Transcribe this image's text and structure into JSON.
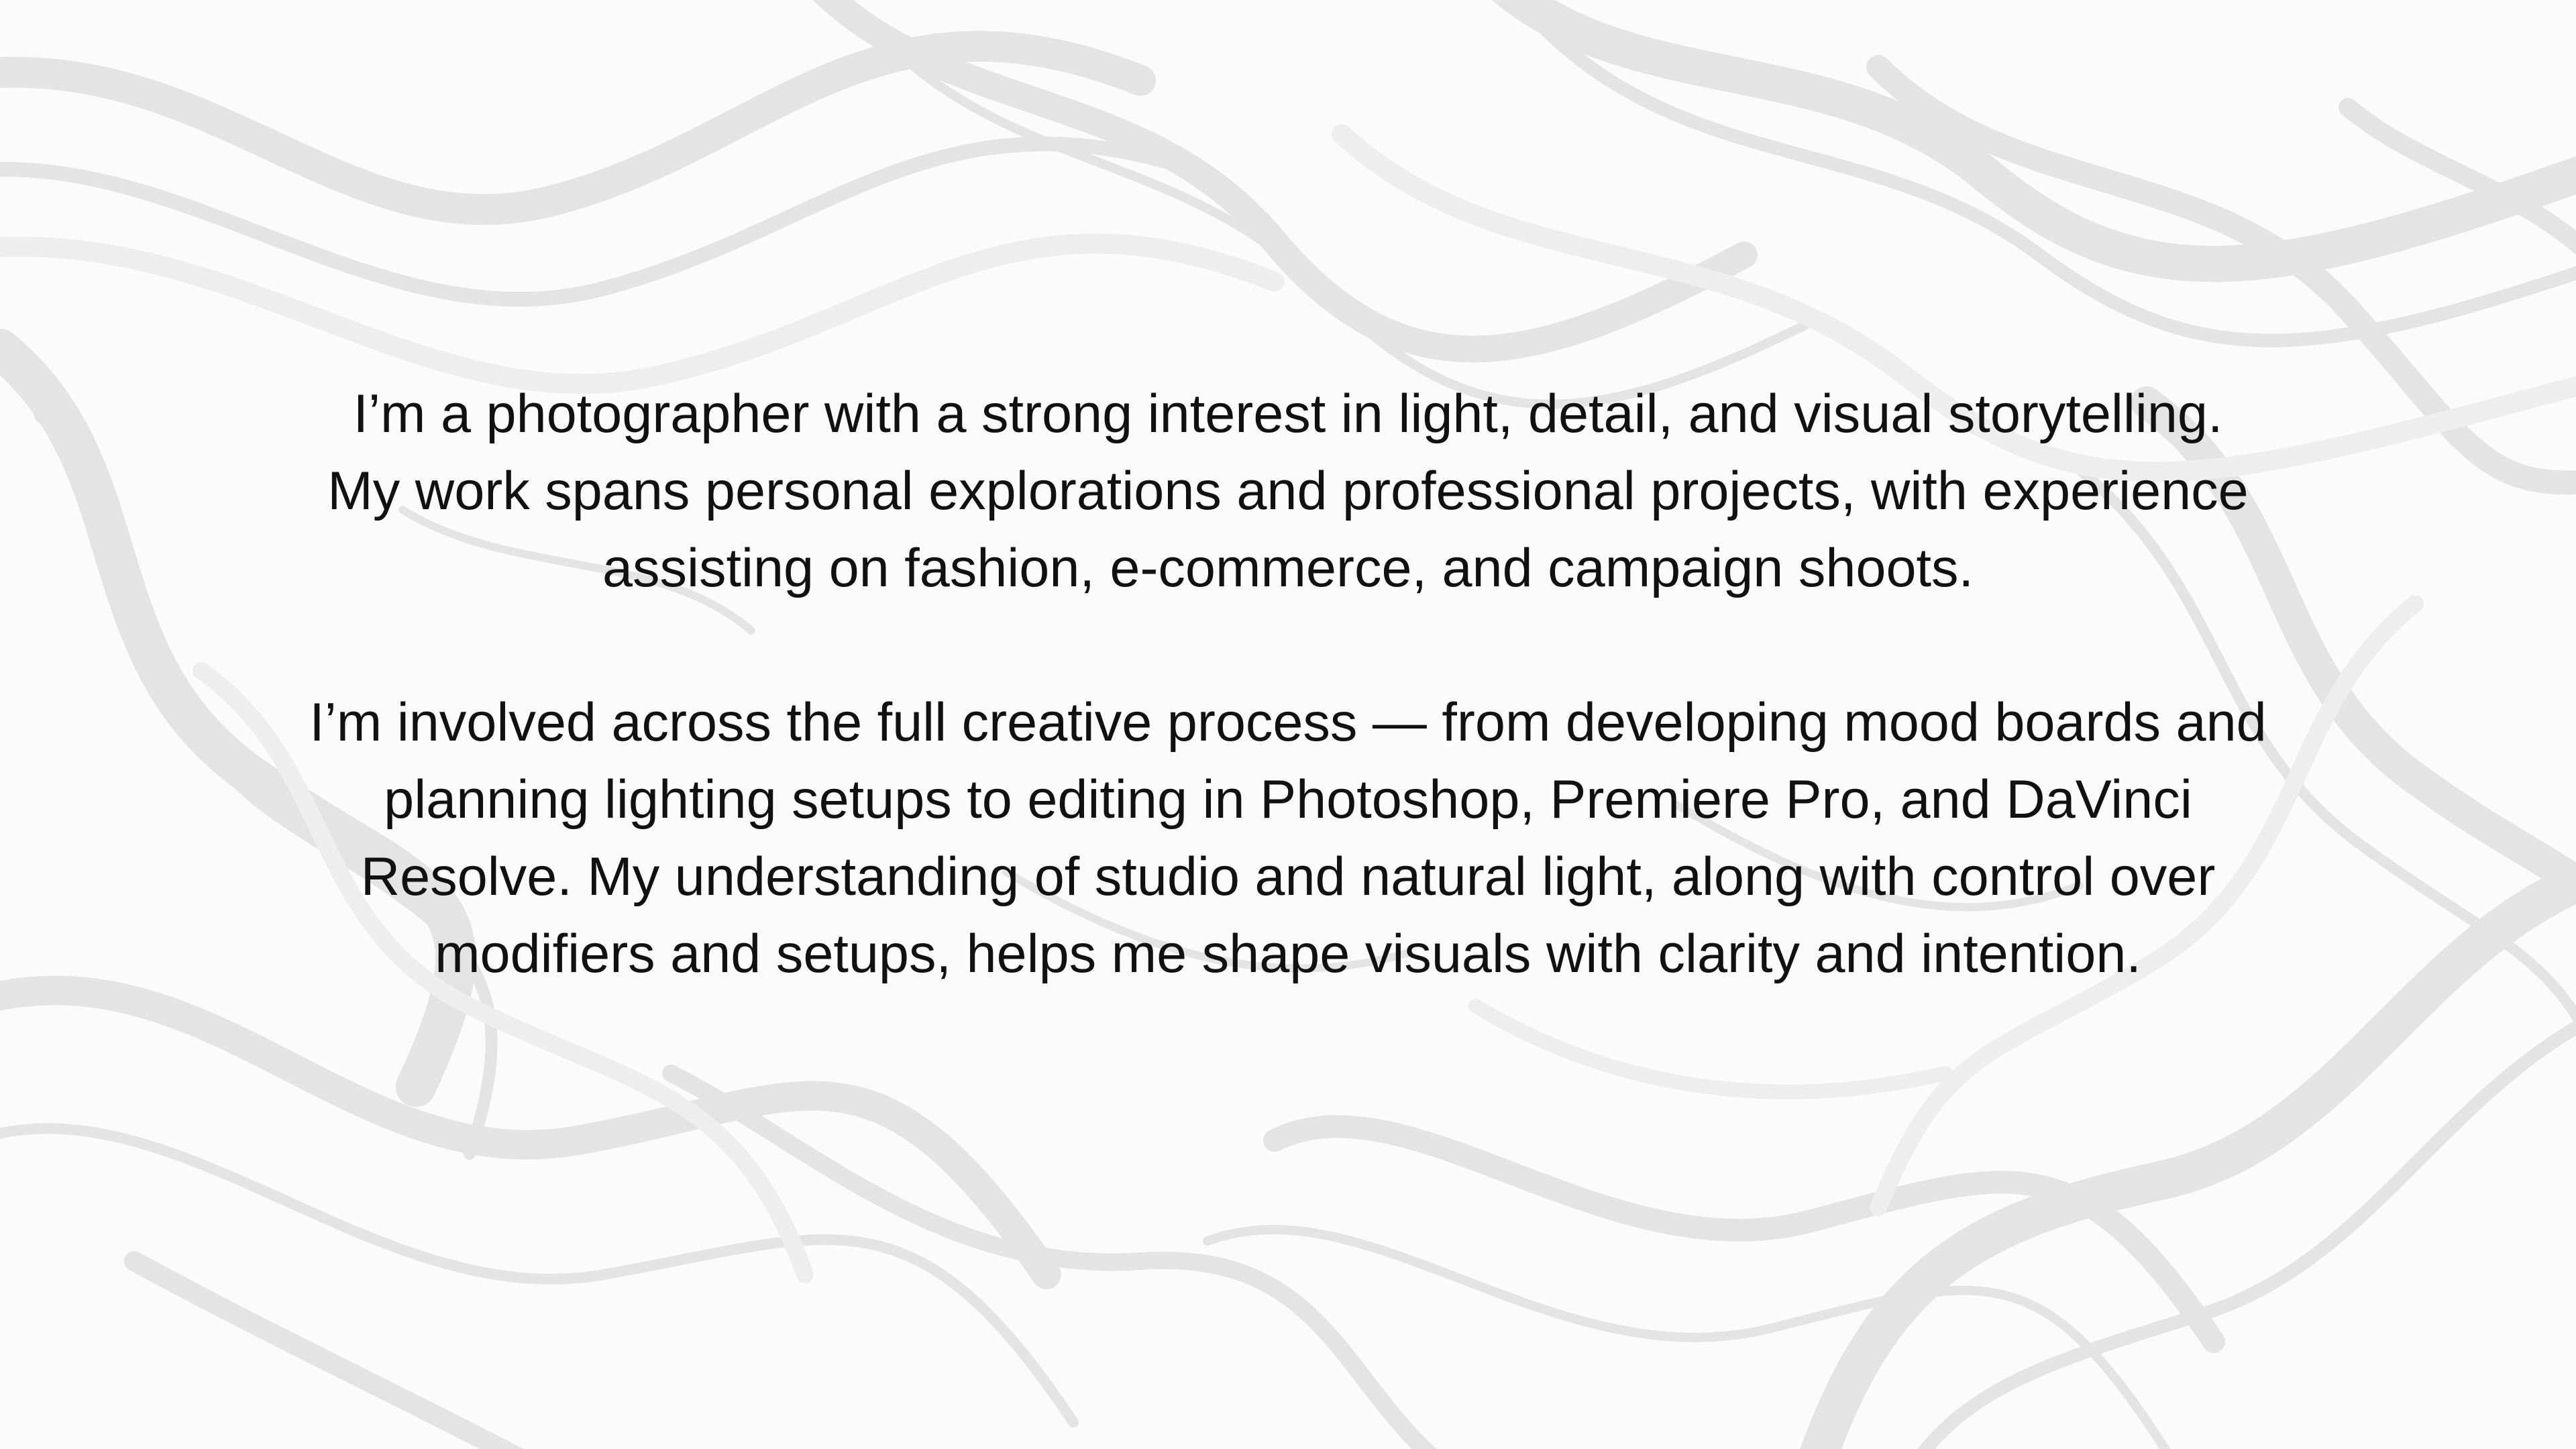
{
  "background": {
    "pattern": "grey-white-marble-swirl",
    "base_color": "#fbfbfb",
    "swirl_color": "#e6e6e6"
  },
  "text_color": "#111111",
  "paragraphs": [
    {
      "lines": [
        "I’m a photographer with a strong interest in light, detail, and visual storytelling.",
        "My work spans personal explorations and professional projects, with experience",
        "assisting on fashion, e-commerce, and campaign shoots."
      ]
    },
    {
      "lines": [
        "I’m involved across the full creative process — from developing mood boards and",
        "planning lighting setups to editing in Photoshop, Premiere Pro, and DaVinci",
        "Resolve. My understanding of  studio and natural light, along with control over",
        "modifiers and setups, helps me shape visuals with clarity and intention."
      ]
    }
  ]
}
